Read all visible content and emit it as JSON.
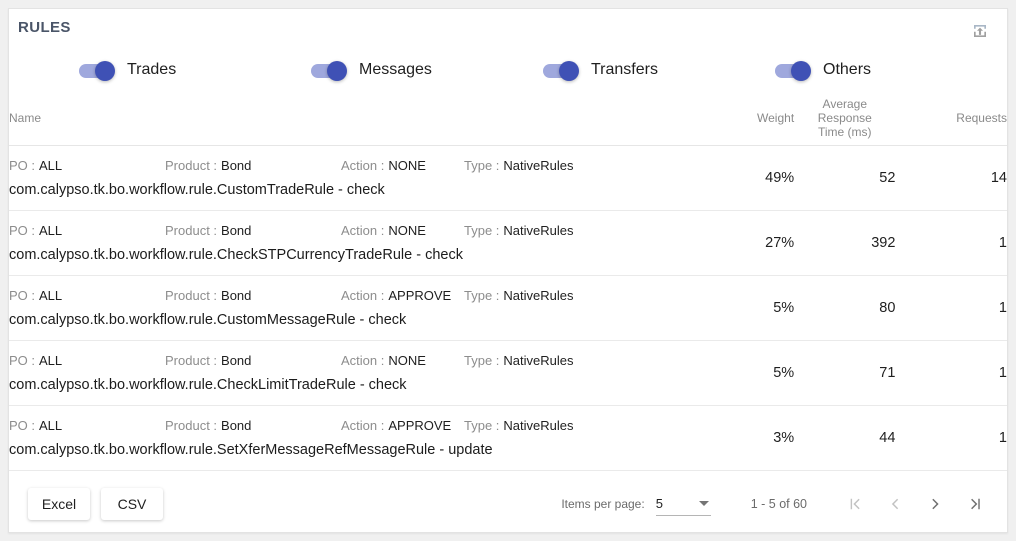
{
  "card": {
    "title": "RULES",
    "export_icon": "export-upload-icon"
  },
  "filters": [
    {
      "label": "Trades",
      "state": "on"
    },
    {
      "label": "Messages",
      "state": "on"
    },
    {
      "label": "Transfers",
      "state": "on"
    },
    {
      "label": "Others",
      "state": "on"
    }
  ],
  "table": {
    "headers": {
      "name": "Name",
      "weight": "Weight",
      "avg_response_line1": "Average",
      "avg_response_line2": "Response",
      "avg_response_line3": "Time (ms)",
      "requests": "Requests"
    },
    "meta_keys": {
      "po": "PO :",
      "product": "Product :",
      "action": "Action :",
      "type": "Type :"
    },
    "rows": [
      {
        "po": "ALL",
        "product": "Bond",
        "action": "NONE",
        "type": "NativeRules",
        "rule": "com.calypso.tk.bo.workflow.rule.CustomTradeRule - check",
        "weight": "49%",
        "avg_response_time": "52",
        "requests": "14"
      },
      {
        "po": "ALL",
        "product": "Bond",
        "action": "NONE",
        "type": "NativeRules",
        "rule": "com.calypso.tk.bo.workflow.rule.CheckSTPCurrencyTradeRule - check",
        "weight": "27%",
        "avg_response_time": "392",
        "requests": "1"
      },
      {
        "po": "ALL",
        "product": "Bond",
        "action": "APPROVE",
        "type": "NativeRules",
        "rule": "com.calypso.tk.bo.workflow.rule.CustomMessageRule - check",
        "weight": "5%",
        "avg_response_time": "80",
        "requests": "1"
      },
      {
        "po": "ALL",
        "product": "Bond",
        "action": "NONE",
        "type": "NativeRules",
        "rule": "com.calypso.tk.bo.workflow.rule.CheckLimitTradeRule - check",
        "weight": "5%",
        "avg_response_time": "71",
        "requests": "1"
      },
      {
        "po": "ALL",
        "product": "Bond",
        "action": "APPROVE",
        "type": "NativeRules",
        "rule": "com.calypso.tk.bo.workflow.rule.SetXferMessageRefMessageRule - update",
        "weight": "3%",
        "avg_response_time": "44",
        "requests": "1"
      }
    ]
  },
  "footer": {
    "excel_label": "Excel",
    "csv_label": "CSV",
    "items_per_page_label": "Items per page:",
    "items_per_page_value": "5",
    "range_label": "1 - 5 of 60",
    "first_page_icon": "first-page-icon",
    "prev_page_icon": "previous-page-icon",
    "next_page_icon": "next-page-icon",
    "last_page_icon": "last-page-icon"
  },
  "colors": {
    "accent": "#3f51b5",
    "track": "#9fa8dd",
    "title": "#4a5568",
    "muted": "#8a8a8a"
  }
}
